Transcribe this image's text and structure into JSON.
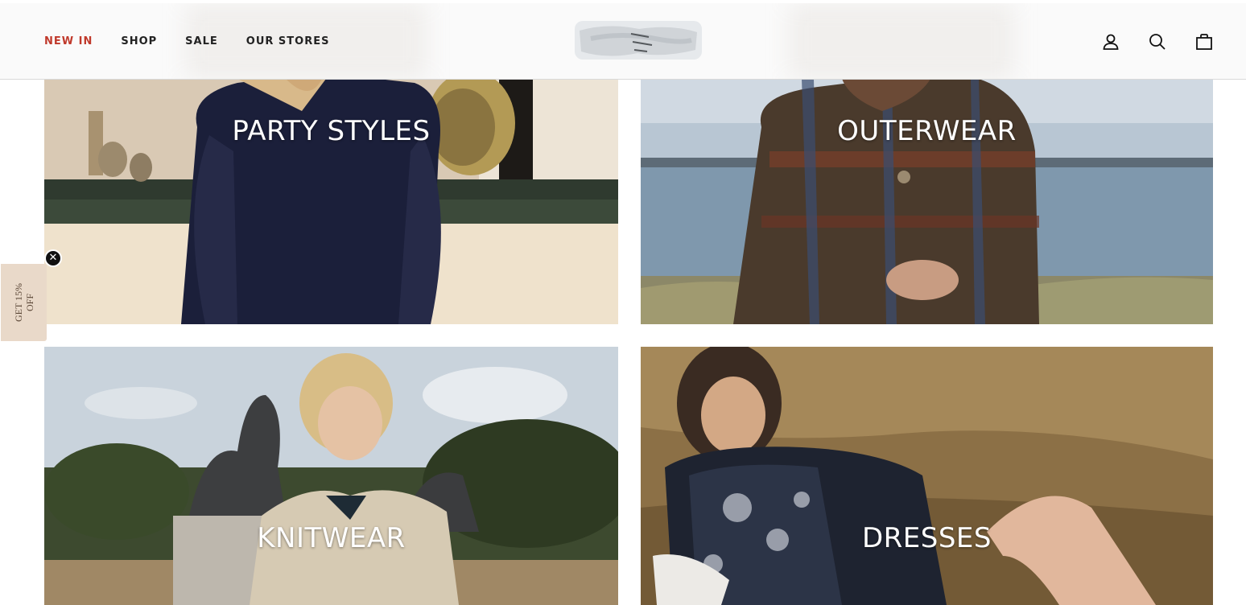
{
  "header": {
    "nav": [
      {
        "label": "NEW IN",
        "active": true
      },
      {
        "label": "SHOP",
        "active": false
      },
      {
        "label": "SALE",
        "active": false
      },
      {
        "label": "OUR STORES",
        "active": false
      }
    ],
    "accent_color": "#c0392b",
    "icons": [
      "account-icon",
      "search-icon",
      "cart-icon"
    ]
  },
  "discount_tab": {
    "line1": "GET 15%",
    "line2": "OFF",
    "close_glyph": "✕"
  },
  "tiles": [
    {
      "label": "PARTY STYLES"
    },
    {
      "label": "OUTERWEAR"
    },
    {
      "label": "KNITWEAR"
    },
    {
      "label": "DRESSES"
    }
  ]
}
